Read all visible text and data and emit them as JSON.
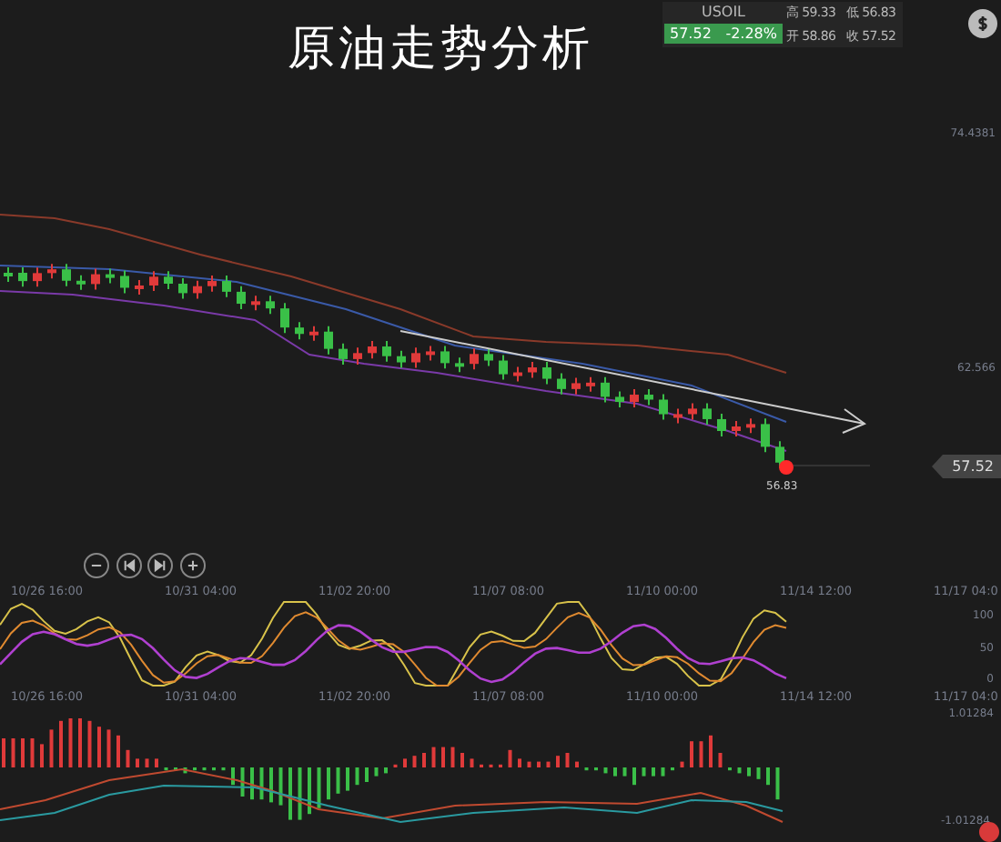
{
  "title": "原油走势分析",
  "quote": {
    "symbol": "USOIL",
    "price": "57.52",
    "change": "-2.28%",
    "stats": [
      {
        "label": "高",
        "value": "59.33"
      },
      {
        "label": "低",
        "value": "56.83"
      },
      {
        "label": "开",
        "value": "58.86"
      },
      {
        "label": "收",
        "value": "57.52"
      }
    ]
  },
  "price_chart": {
    "scale": [
      "74.4381",
      "62.566"
    ],
    "last_price": "57.52",
    "low_marker": "56.83"
  },
  "time_axes": [
    {
      "labels": [
        "10/26 16:00",
        "10/31 04:00",
        "11/02 20:00",
        "11/07 08:00",
        "11/10 00:00",
        "11/14 12:00",
        "11/17 04:0"
      ]
    },
    {
      "labels": [
        "10/26 16:00",
        "10/31 04:00",
        "11/02 20:00",
        "11/07 08:00",
        "11/10 00:00",
        "11/14 12:00",
        "11/17 04:0"
      ]
    }
  ],
  "oscillator": {
    "scale": [
      "100",
      "50",
      "0"
    ]
  },
  "macd": {
    "scale": [
      "1.01284",
      "-1.01284"
    ]
  }
}
